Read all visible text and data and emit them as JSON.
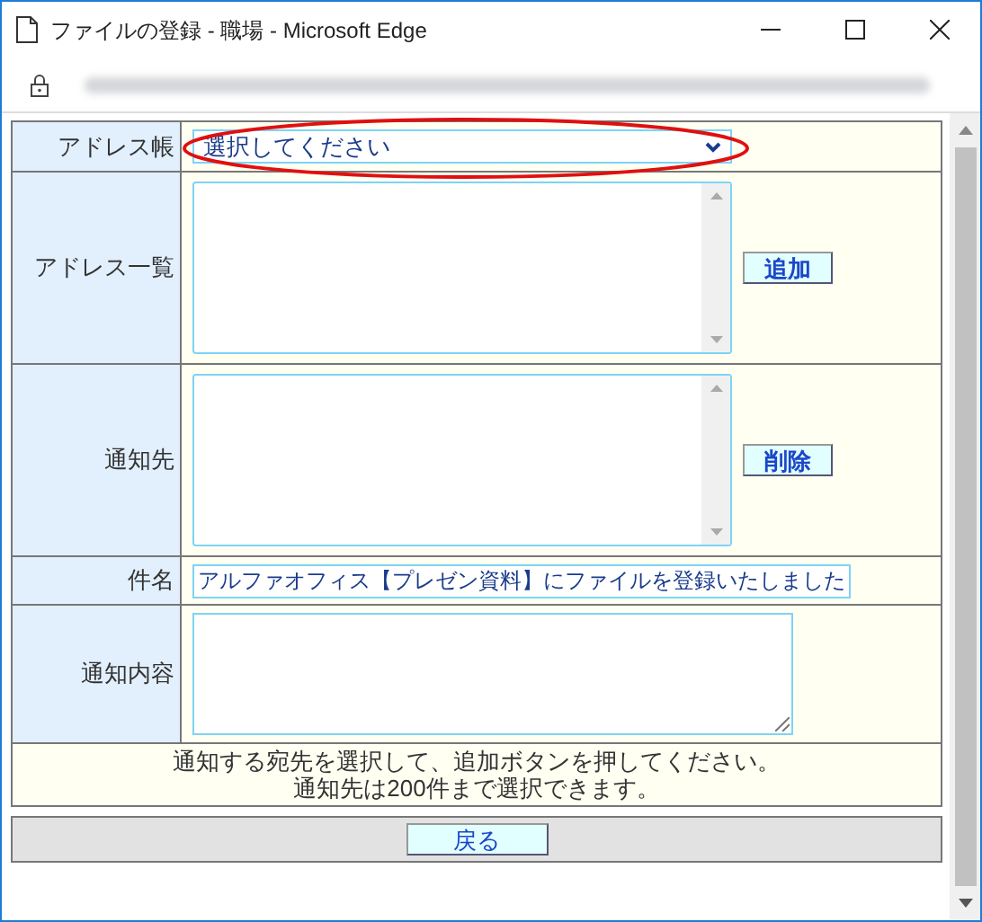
{
  "window": {
    "title": "ファイルの登録 - 職場 - Microsoft Edge"
  },
  "form": {
    "rows": [
      {
        "label": "アドレス帳",
        "kind": "select",
        "value": "選択してください"
      },
      {
        "label": "アドレス一覧",
        "kind": "listbox",
        "button": "追加"
      },
      {
        "label": "通知先",
        "kind": "listbox",
        "button": "削除"
      },
      {
        "label": "件名",
        "kind": "text",
        "value": "アルファオフィス【プレゼン資料】にファイルを登録いたしました"
      },
      {
        "label": "通知内容",
        "kind": "textarea"
      }
    ],
    "notes": [
      "通知する宛先を選択して、追加ボタンを押してください。",
      "通知先は200件まで選択できます。"
    ],
    "back_button": "戻る"
  }
}
